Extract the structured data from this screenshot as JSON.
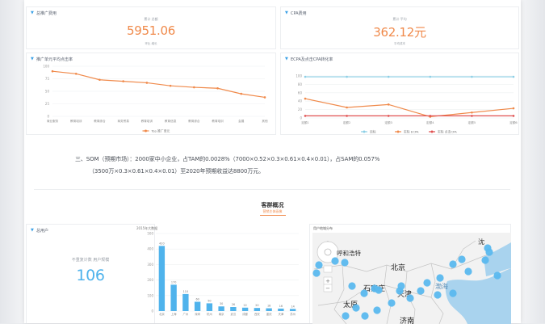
{
  "kpi1": {
    "title": "总推广费用",
    "sub": "累计 总额",
    "value": "5951.06",
    "foot_prefix": "环比 增长 ",
    "foot_value": "",
    "foot_suffix": ""
  },
  "kpi2": {
    "title": "CPA费用",
    "sub": "累计 平均",
    "value": "362.12元",
    "foot_prefix": "平均成本",
    "foot_value": "",
    "foot_suffix": ""
  },
  "chart1_title": "推广单元平均点击率",
  "chart2_title": "ECPA及点击CPA转化率",
  "chart_data": [
    {
      "type": "line",
      "x": [
        "商业服务",
        "教育培训",
        "教育综合",
        "商务贸易",
        "教育培训",
        "教育信息",
        "教育综合",
        "教育培训",
        "会展",
        "其他"
      ],
      "ylim": [
        0,
        100
      ],
      "yticks": [
        "100",
        "75",
        "50",
        "25",
        "0"
      ],
      "series": [
        {
          "name": "Top 推广单元",
          "values": [
            90,
            85,
            73,
            70,
            67,
            61,
            58,
            56,
            45,
            38
          ],
          "color": "#f08a4b"
        }
      ]
    },
    {
      "type": "line",
      "x": [
        "定额1",
        "定额2",
        "定额3",
        "定额4",
        "定额5",
        "定额6"
      ],
      "ylim": [
        0,
        100
      ],
      "yticks": [
        "100",
        "80",
        "60",
        "40",
        "20",
        "0"
      ],
      "series": [
        {
          "name": "目标",
          "values": [
            98,
            98,
            98,
            98,
            98,
            98
          ],
          "color": "#8ccfe6"
        },
        {
          "name": "实际 ECPA",
          "values": [
            46,
            25,
            32,
            3,
            13,
            23
          ],
          "color": "#f08a4b"
        },
        {
          "name": "实际 点击CPA",
          "values": [
            5,
            5,
            5,
            5,
            5,
            5
          ],
          "color": "#e05050"
        }
      ]
    },
    {
      "type": "bar",
      "title": "2015年大数据",
      "categories": [
        "北京",
        "上海",
        "广州",
        "深圳",
        "杭州",
        "南京",
        "武汉",
        "成都",
        "西安",
        "重庆",
        "天津",
        "苏州"
      ],
      "values": [
        420,
        170,
        110,
        60,
        50,
        30,
        26,
        22,
        20,
        18,
        16,
        14
      ],
      "ylim": [
        0,
        500
      ],
      "yticks": [
        "500",
        "400",
        "300",
        "200",
        "100",
        "0"
      ],
      "color": "#4fb3ec"
    }
  ],
  "para": {
    "line1": "三、SOM（预期市场）：2000家中小企业，占TAM的0.0028%（7000×0.52×0.3×0.61×0.4×0.01），占SAM的0.057%",
    "line2": "（3500万×0.3×0.61×0.4×0.01）至2020年预期收益达8800万元。"
  },
  "section": {
    "title": "客群概况",
    "sub": "营销主体画像"
  },
  "users": {
    "title": "总用户",
    "sub": "不重复计数 用户规模",
    "value": "106"
  },
  "bar_title": "2015年大数据",
  "map": {
    "title": "用户地域分布",
    "cities": {
      "beijing": "北京",
      "shijiazhuang": "石家庄",
      "tianjin": "天津",
      "bohai": "渤海",
      "hohhot": "呼和浩特",
      "taiyuan": "太原",
      "jinan": "济南",
      "shen": "沈"
    }
  },
  "colors": {
    "accent": "#f08a4b",
    "blue": "#3ba1e6",
    "bubble": "#5ab8ee"
  }
}
